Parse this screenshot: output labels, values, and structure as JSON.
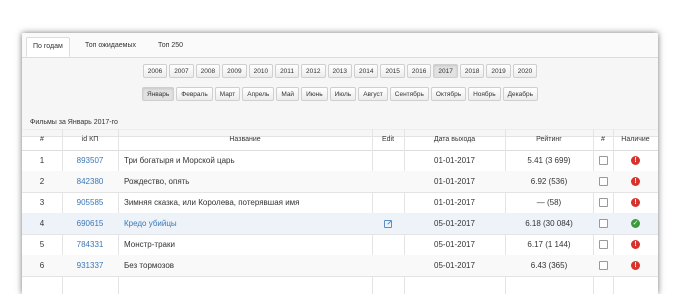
{
  "tabs": [
    "По годам",
    "Топ ожидаемых",
    "Топ 250"
  ],
  "years": [
    "2006",
    "2007",
    "2008",
    "2009",
    "2010",
    "2011",
    "2012",
    "2013",
    "2014",
    "2015",
    "2016",
    "2017",
    "2018",
    "2019",
    "2020"
  ],
  "selected_year": "2017",
  "months": [
    "Январь",
    "Февраль",
    "Март",
    "Апрель",
    "Май",
    "Июнь",
    "Июль",
    "Август",
    "Сентябрь",
    "Октябрь",
    "Ноябрь",
    "Декабрь"
  ],
  "selected_month": "Январь",
  "caption": "Фильмы за Январь 2017-го",
  "columns": [
    "#",
    "id КП",
    "Название",
    "Edit",
    "Дата выхода",
    "Рейтинг",
    "#",
    "Наличие"
  ],
  "rows": [
    {
      "n": "1",
      "id": "893507",
      "title": "Три богатыря и Морской царь",
      "edit": false,
      "date": "01-01-2017",
      "rating": "5.41  (3 699)",
      "status": "missing"
    },
    {
      "n": "2",
      "id": "842380",
      "title": "Рождество, опять",
      "edit": false,
      "date": "01-01-2017",
      "rating": "6.92  (536)",
      "status": "missing"
    },
    {
      "n": "3",
      "id": "905585",
      "title": "Зимняя сказка, или Королева, потерявшая имя",
      "edit": false,
      "date": "01-01-2017",
      "rating": "— (58)",
      "status": "missing"
    },
    {
      "n": "4",
      "id": "690615",
      "title": "Кредо убийцы",
      "edit": true,
      "date": "05-01-2017",
      "rating": "6.18  (30 084)",
      "status": "available"
    },
    {
      "n": "5",
      "id": "784331",
      "title": "Монстр-траки",
      "edit": false,
      "date": "05-01-2017",
      "rating": "6.17  (1 144)",
      "status": "missing"
    },
    {
      "n": "6",
      "id": "931337",
      "title": "Без тормозов",
      "edit": false,
      "date": "05-01-2017",
      "rating": "6.43  (365)",
      "status": "missing"
    }
  ],
  "colors": {
    "link": "#3a78b5",
    "missing": "#d9312b",
    "available": "#3c9a3c"
  }
}
